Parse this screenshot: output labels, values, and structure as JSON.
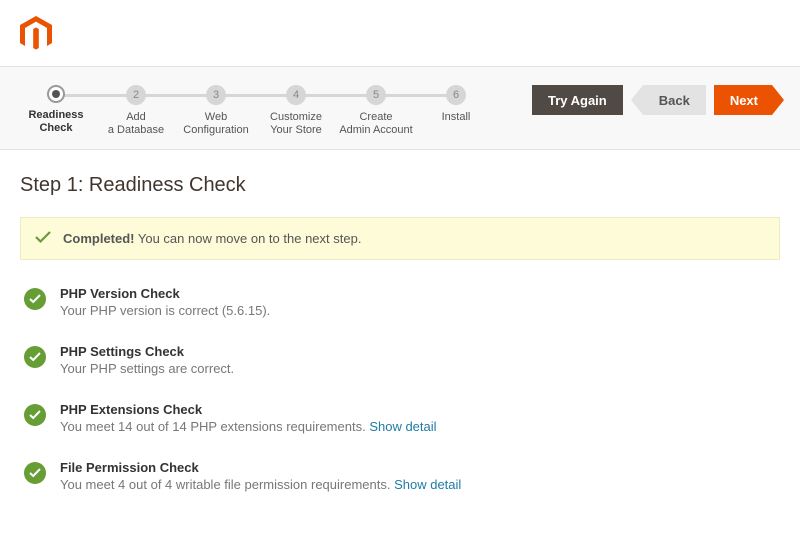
{
  "steps": [
    {
      "num": "",
      "l1": "Readiness",
      "l2": "Check",
      "active": true
    },
    {
      "num": "2",
      "l1": "Add",
      "l2": "a Database",
      "active": false
    },
    {
      "num": "3",
      "l1": "Web",
      "l2": "Configuration",
      "active": false
    },
    {
      "num": "4",
      "l1": "Customize",
      "l2": "Your Store",
      "active": false
    },
    {
      "num": "5",
      "l1": "Create",
      "l2": "Admin Account",
      "active": false
    },
    {
      "num": "6",
      "l1": "Install",
      "l2": "",
      "active": false
    }
  ],
  "actions": {
    "try_again": "Try Again",
    "back": "Back",
    "next": "Next"
  },
  "page_title": "Step 1: Readiness Check",
  "alert": {
    "bold": "Completed!",
    "rest": " You can now move on to the next step."
  },
  "checks": [
    {
      "title": "PHP Version Check",
      "sub": "Your PHP version is correct (5.6.15).",
      "link": null
    },
    {
      "title": "PHP Settings Check",
      "sub": "Your PHP settings are correct.",
      "link": null
    },
    {
      "title": "PHP Extensions Check",
      "sub": "You meet 14 out of 14 PHP extensions requirements. ",
      "link": "Show detail"
    },
    {
      "title": "File Permission Check",
      "sub": "You meet 4 out of 4 writable file permission requirements. ",
      "link": "Show detail"
    }
  ]
}
